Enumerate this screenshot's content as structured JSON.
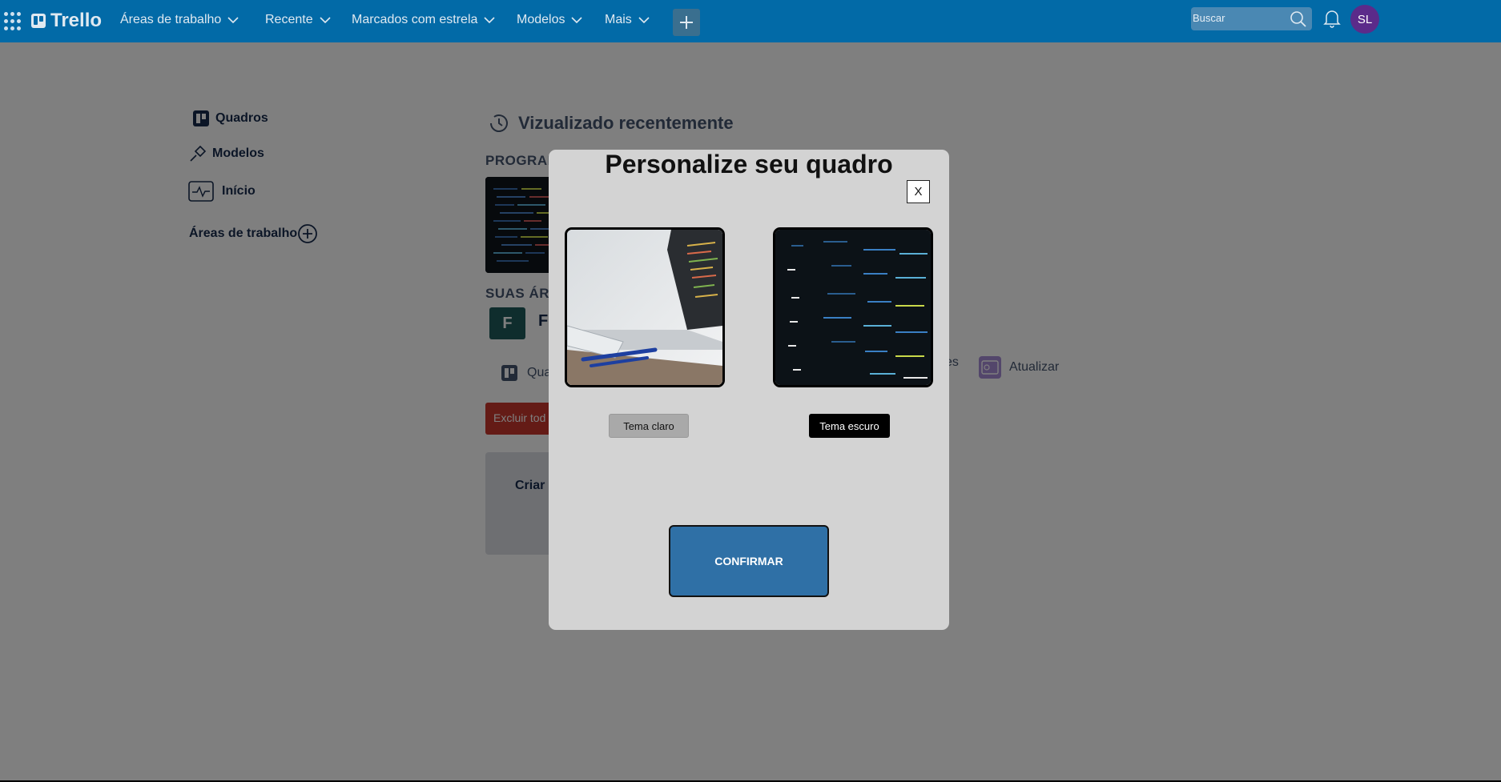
{
  "topbar": {
    "logo": "Trello",
    "menus": [
      {
        "label": "Áreas de trabalho"
      },
      {
        "label": "Recente"
      },
      {
        "label": "Marcados com estrela"
      },
      {
        "label": "Modelos"
      },
      {
        "label": "Mais"
      }
    ],
    "search_placeholder": "Buscar",
    "avatar_initials": "SL",
    "colors": {
      "bar": "#026aa7",
      "avatar": "#5b2b8a"
    }
  },
  "sidebar": {
    "items": [
      {
        "label": "Quadros",
        "icon": "board-icon"
      },
      {
        "label": "Modelos",
        "icon": "template-icon"
      },
      {
        "label": "Início",
        "icon": "activity-icon"
      }
    ],
    "workspaces_label": "Áreas de trabalho"
  },
  "main": {
    "recent_title": "Vizualizado recentemente",
    "board_section": "PROGRAM",
    "workspaces_section": "SUAS ÁR",
    "workspace_initial": "F",
    "workspace_name": "F",
    "boards_link": "Qua",
    "settings_link_fragment": "es",
    "upgrade_link": "Atualizar",
    "delete_button": "Excluir tod",
    "create_card": "Criar"
  },
  "modal": {
    "title": "Personalize seu quadro",
    "close_label": "X",
    "light_theme_label": "Tema claro",
    "dark_theme_label": "Tema escuro",
    "confirm_label": "CONFIRMAR"
  }
}
